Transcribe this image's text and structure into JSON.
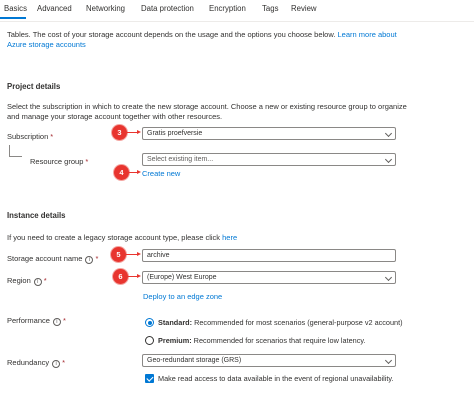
{
  "tabs": [
    {
      "label": "Basics",
      "active": true
    },
    {
      "label": "Advanced"
    },
    {
      "label": "Networking"
    },
    {
      "label": "Data protection"
    },
    {
      "label": "Encryption"
    },
    {
      "label": "Tags"
    },
    {
      "label": "Review"
    }
  ],
  "intro": {
    "text": "Tables. The cost of your storage account depends on the usage and the options you choose below. ",
    "link": "Learn more about Azure storage accounts"
  },
  "project": {
    "title": "Project details",
    "description": "Select the subscription in which to create the new storage account. Choose a new or existing resource group to organize and manage your storage account together with other resources.",
    "subscription_label": "Subscription",
    "subscription_value": "Gratis proefversie",
    "resource_group_label": "Resource group",
    "resource_group_placeholder": "Select existing item...",
    "create_new": "Create new"
  },
  "instance": {
    "title": "Instance details",
    "description": "If you need to create a legacy storage account type, please click ",
    "here_link": "here",
    "name_label": "Storage account name",
    "name_value": "archive",
    "region_label": "Region",
    "region_value": "(Europe) West Europe",
    "edge_zone_link": "Deploy to an edge zone",
    "performance_label": "Performance",
    "standard_bold": "Standard:",
    "standard_text": " Recommended for most scenarios (general-purpose v2 account)",
    "premium_bold": "Premium:",
    "premium_text": " Recommended for scenarios that require low latency.",
    "redundancy_label": "Redundancy",
    "redundancy_value": "Geo-redundant storage (GRS)",
    "read_access_text": "Make read access to data available in the event of regional unavailability."
  },
  "markers": {
    "m3": "3",
    "m4": "4",
    "m5": "5",
    "m6": "6"
  },
  "symbols": {
    "required": "*",
    "info": "i"
  },
  "colors": {
    "accent": "#0078d4",
    "marker": "#e8352f"
  }
}
